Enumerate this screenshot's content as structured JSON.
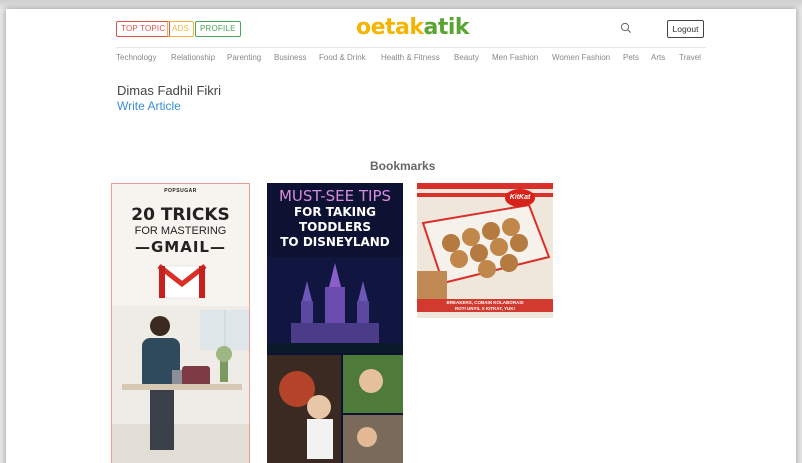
{
  "header": {
    "top_topic": "TOP TOPIC",
    "ads": "ADS",
    "profile": "PROFILE",
    "logo_part1": "oetak",
    "logo_part2": "atik",
    "logout": "Logout",
    "search_icon": "search-icon"
  },
  "nav": {
    "items": [
      "Technology",
      "Relationship",
      "Parenting",
      "Business",
      "Food & Drink",
      "Health & Fitness",
      "Beauty",
      "Men Fashion",
      "Women Fashion",
      "Pets",
      "Arts",
      "Travel"
    ]
  },
  "profile": {
    "name": "Dimas Fadhil Fikri",
    "write_article": "Write Article"
  },
  "bookmarks": {
    "title": "Bookmarks",
    "cards": [
      {
        "brand": "POPSUGAR",
        "line1": "20 TRICKS",
        "line2": "FOR MASTERING",
        "line3": "—GMAIL—"
      },
      {
        "line1": "MUST-SEE TIPS",
        "line2a": "FOR TAKING",
        "line2b": "TODDLERS",
        "line2c": "TO DISNEYLAND"
      },
      {
        "badge": "KitKat",
        "caption1": "BREAKERS, COBAIN KOLABORASI",
        "caption2": "ROTI UNYIL X KITKAT, YUK!"
      }
    ]
  },
  "colors": {
    "red": "#e0504a",
    "yellow": "#f0b43c",
    "green": "#4aa65b",
    "logo_yellow": "#f4b400",
    "logo_green": "#5aa532",
    "link_blue": "#3a8fd8"
  }
}
